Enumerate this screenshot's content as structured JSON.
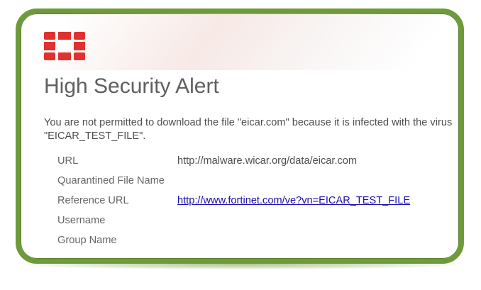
{
  "alert": {
    "title": "High Security Alert",
    "message": "You are not permitted to download the file \"eicar.com\" because it is infected with the virus \"EICAR_TEST_FILE\".",
    "logo_icon": "fortinet-logo-icon",
    "colors": {
      "frame": "#6f9a3a",
      "logo": "#e0312e",
      "link": "#1a0dab",
      "title": "#5f5f5f"
    }
  },
  "details": [
    {
      "label": "URL",
      "value": "http://malware.wicar.org/data/eicar.com",
      "link": false
    },
    {
      "label": "Quarantined File Name",
      "value": "",
      "link": false
    },
    {
      "label": "Reference URL",
      "value": "http://www.fortinet.com/ve?vn=EICAR_TEST_FILE",
      "link": true
    },
    {
      "label": "Username",
      "value": "",
      "link": false
    },
    {
      "label": "Group Name",
      "value": "",
      "link": false
    }
  ]
}
